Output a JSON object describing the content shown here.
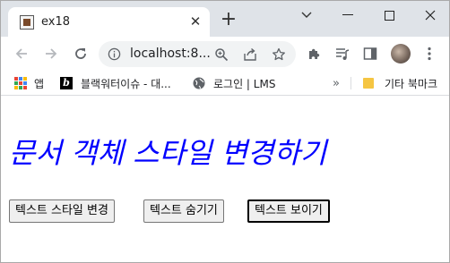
{
  "browser": {
    "tab": {
      "title": "ex18",
      "close_glyph": "✕"
    },
    "new_tab_glyph": "+",
    "address": {
      "url": "localhost:8..."
    },
    "bookmarks": {
      "apps": "앱",
      "blog": "블랙워터이슈 - 대...",
      "lms": "로그인 | LMS",
      "more": "»",
      "other": "기타 북마크"
    }
  },
  "page": {
    "heading": "문서 객체 스타일 변경하기",
    "buttons": {
      "change_style": "텍스트 스타일 변경",
      "hide_text": "텍스트 숨기기",
      "show_text": "텍스트 보이기"
    },
    "heading_color": "#0000ff"
  },
  "icons": {
    "back": "arrow-left-icon",
    "forward": "arrow-right-icon",
    "reload": "reload-icon",
    "info": "info-icon",
    "zoom": "zoom-icon",
    "share": "share-icon",
    "star": "star-icon",
    "extensions": "puzzle-icon",
    "media": "media-queue-icon",
    "side_panel": "side-panel-icon",
    "menu": "kebab-menu-icon"
  }
}
